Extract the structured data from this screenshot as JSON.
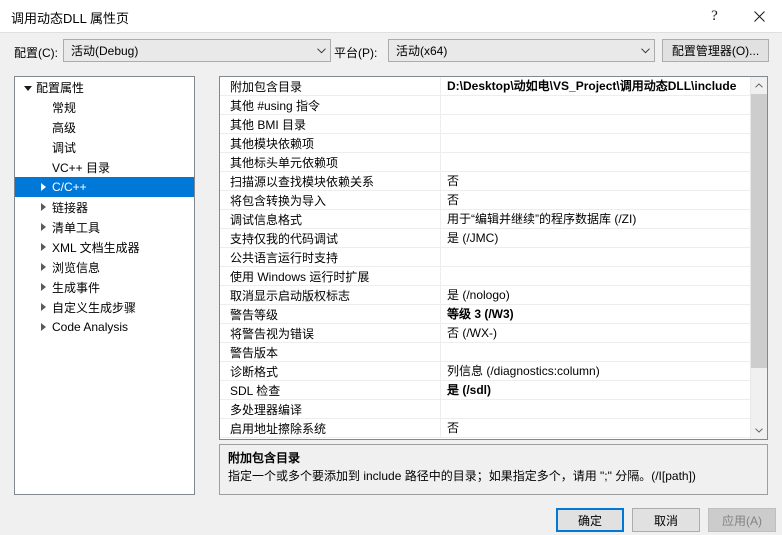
{
  "window": {
    "title": "调用动态DLL 属性页",
    "help_icon": "help-icon",
    "help_glyph": "?",
    "close_icon": "close-icon"
  },
  "header": {
    "configuration_label": "配置(C):",
    "configuration_value": "活动(Debug)",
    "platform_label": "平台(P):",
    "platform_value": "活动(x64)",
    "config_manager_button": "配置管理器(O)..."
  },
  "tree": {
    "items": [
      {
        "label": "配置属性",
        "indent": 0,
        "twisty": "expanded",
        "selected": false
      },
      {
        "label": "常规",
        "indent": 1,
        "twisty": "none",
        "selected": false
      },
      {
        "label": "高级",
        "indent": 1,
        "twisty": "none",
        "selected": false
      },
      {
        "label": "调试",
        "indent": 1,
        "twisty": "none",
        "selected": false
      },
      {
        "label": "VC++ 目录",
        "indent": 1,
        "twisty": "none",
        "selected": false
      },
      {
        "label": "C/C++",
        "indent": 1,
        "twisty": "collapsed",
        "selected": true
      },
      {
        "label": "链接器",
        "indent": 1,
        "twisty": "collapsed",
        "selected": false
      },
      {
        "label": "清单工具",
        "indent": 1,
        "twisty": "collapsed",
        "selected": false
      },
      {
        "label": "XML 文档生成器",
        "indent": 1,
        "twisty": "collapsed",
        "selected": false
      },
      {
        "label": "浏览信息",
        "indent": 1,
        "twisty": "collapsed",
        "selected": false
      },
      {
        "label": "生成事件",
        "indent": 1,
        "twisty": "collapsed",
        "selected": false
      },
      {
        "label": "自定义生成步骤",
        "indent": 1,
        "twisty": "collapsed",
        "selected": false
      },
      {
        "label": "Code Analysis",
        "indent": 1,
        "twisty": "collapsed",
        "selected": false
      }
    ]
  },
  "grid": {
    "rows": [
      {
        "name": "附加包含目录",
        "value": "D:\\Desktop\\动如电\\VS_Project\\调用动态DLL\\include",
        "bold": true
      },
      {
        "name": "其他 #using 指令",
        "value": "",
        "bold": false
      },
      {
        "name": "其他 BMI 目录",
        "value": "",
        "bold": false
      },
      {
        "name": "其他模块依赖项",
        "value": "",
        "bold": false
      },
      {
        "name": "其他标头单元依赖项",
        "value": "",
        "bold": false
      },
      {
        "name": "扫描源以查找模块依赖关系",
        "value": "否",
        "bold": false
      },
      {
        "name": "将包含转换为导入",
        "value": "否",
        "bold": false
      },
      {
        "name": "调试信息格式",
        "value": "用于“编辑并继续”的程序数据库 (/ZI)",
        "bold": false
      },
      {
        "name": "支持仅我的代码调试",
        "value": "是 (/JMC)",
        "bold": false
      },
      {
        "name": "公共语言运行时支持",
        "value": "",
        "bold": false
      },
      {
        "name": "使用 Windows 运行时扩展",
        "value": "",
        "bold": false
      },
      {
        "name": "取消显示启动版权标志",
        "value": "是 (/nologo)",
        "bold": false
      },
      {
        "name": "警告等级",
        "value": "等级 3 (/W3)",
        "bold": true
      },
      {
        "name": "将警告视为错误",
        "value": "否 (/WX-)",
        "bold": false
      },
      {
        "name": "警告版本",
        "value": "",
        "bold": false
      },
      {
        "name": "诊断格式",
        "value": "列信息 (/diagnostics:column)",
        "bold": false
      },
      {
        "name": "SDL 检查",
        "value": "是 (/sdl)",
        "bold": true
      },
      {
        "name": "多处理器编译",
        "value": "",
        "bold": false
      },
      {
        "name": "启用地址擦除系统",
        "value": "否",
        "bold": false
      }
    ],
    "scroll_up_icon": "chevron-up-icon",
    "scroll_down_icon": "chevron-down-icon"
  },
  "description": {
    "title": "附加包含目录",
    "body": "指定一个或多个要添加到 include 路径中的目录；如果指定多个，请用 \";\" 分隔。(/I[path])"
  },
  "footer": {
    "ok_label": "确定",
    "cancel_label": "取消",
    "apply_label": "应用(A)",
    "apply_disabled": true
  },
  "colors": {
    "accent": "#0078D7",
    "dialog_bg": "#F0F0F0",
    "panel_bg": "#FFFFFF",
    "close_hover": "#E81123"
  }
}
